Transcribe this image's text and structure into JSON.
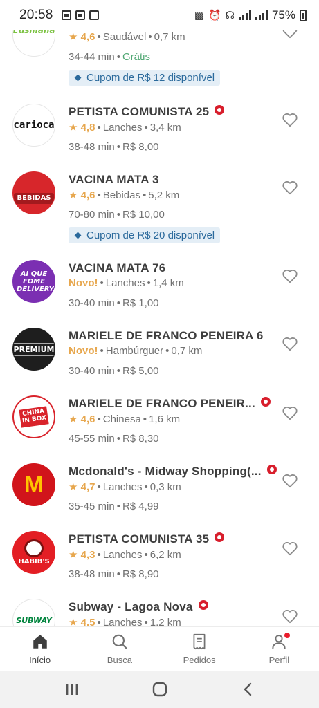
{
  "status_bar": {
    "time": "20:58",
    "battery": "75%"
  },
  "restaurants": [
    {
      "logo_label": "Eusiliana",
      "name": "",
      "rating": "4,6",
      "category": "Saudável",
      "distance": "0,7 km",
      "time": "34-44 min",
      "fee": "Grátis",
      "coupon": "Cupom de R$ 12 disponível",
      "super": false,
      "novo": ""
    },
    {
      "logo_label": "carioca",
      "name": "PETISTA COMUNISTA 25",
      "rating": "4,8",
      "category": "Lanches",
      "distance": "3,4 km",
      "time": "38-48 min",
      "fee": "R$ 8,00",
      "coupon": "",
      "super": true,
      "novo": ""
    },
    {
      "logo_label": "BEBIDAS",
      "name": "VACINA MATA 3",
      "rating": "4,6",
      "category": "Bebidas",
      "distance": "5,2 km",
      "time": "70-80 min",
      "fee": "R$ 10,00",
      "coupon": "Cupom de R$ 20 disponível",
      "super": false,
      "novo": ""
    },
    {
      "logo_label": "AI QUE FOME DELIVERY",
      "name": "VACINA MATA 76",
      "rating": "",
      "category": "Lanches",
      "distance": "1,4 km",
      "time": "30-40 min",
      "fee": "R$ 1,00",
      "coupon": "",
      "super": false,
      "novo": "Novo!"
    },
    {
      "logo_label": "PREMIUM",
      "name": "MARIELE DE FRANCO PENEIRA 6",
      "rating": "",
      "category": "Hambúrguer",
      "distance": "0,7 km",
      "time": "30-40 min",
      "fee": "R$ 5,00",
      "coupon": "",
      "super": false,
      "novo": "Novo!"
    },
    {
      "logo_label": "CHINA IN BOX",
      "name": "MARIELE DE FRANCO PENEIR...",
      "rating": "4,6",
      "category": "Chinesa",
      "distance": "1,6 km",
      "time": "45-55 min",
      "fee": "R$ 8,30",
      "coupon": "",
      "super": true,
      "novo": ""
    },
    {
      "logo_label": "M",
      "name": "Mcdonald's - Midway Shopping(...",
      "rating": "4,7",
      "category": "Lanches",
      "distance": "0,3 km",
      "time": "35-45 min",
      "fee": "R$ 4,99",
      "coupon": "",
      "super": true,
      "novo": ""
    },
    {
      "logo_label": "HABIB'S",
      "name": "PETISTA COMUNISTA 35",
      "rating": "4,3",
      "category": "Lanches",
      "distance": "6,2 km",
      "time": "38-48 min",
      "fee": "R$ 8,90",
      "coupon": "",
      "super": true,
      "novo": ""
    },
    {
      "logo_label": "SUBWAY",
      "name": "Subway - Lagoa Nova",
      "rating": "4,5",
      "category": "Lanches",
      "distance": "1,2 km",
      "time": "",
      "fee": "",
      "coupon": "",
      "super": true,
      "novo": ""
    }
  ],
  "bottom_nav": {
    "inicio": "Início",
    "busca": "Busca",
    "pedidos": "Pedidos",
    "perfil": "Perfil"
  },
  "colors": {
    "accent": "#ea1d2c",
    "rating": "#e7a74e",
    "free": "#50a773",
    "coupon_bg": "#e4eef6",
    "coupon_text": "#2b6a9c"
  },
  "icons": [
    "heart-outline-icon",
    "star-icon",
    "super-restaurant-icon",
    "home-icon",
    "search-icon",
    "receipt-icon",
    "user-icon"
  ]
}
